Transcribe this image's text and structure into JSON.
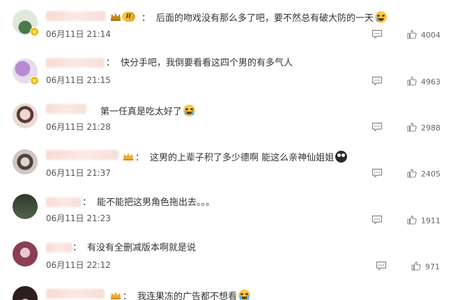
{
  "comments": [
    {
      "text": "后面的吻戏没有那么多了吧，要不然总有破大防的一天",
      "time": "06月11日 21:14",
      "likes": "4004",
      "colon": "：",
      "level_badge": "II",
      "emoji": "laugh-cry-emoji",
      "avatar_color": "#c9d8c2"
    },
    {
      "text": "快分手吧，我倒要看看这四个男的有多气人",
      "time": "06月11日 21:15",
      "likes": "4963",
      "colon": "：",
      "emoji": "",
      "avatar_color": "#d8c3e6"
    },
    {
      "text": "第一任真是吃太好了",
      "time": "06月11日 21:28",
      "likes": "2988",
      "colon": "",
      "emoji": "crying-emoji",
      "avatar_color": "#d5b9b4"
    },
    {
      "text": "这男的上辈子积了多少德啊 能这么亲神仙姐姐",
      "time": "06月11日 21:37",
      "likes": "2405",
      "colon": "：",
      "emoji": "dark-face-emoji",
      "avatar_color": "#b9b0ab"
    },
    {
      "text": "能不能把这男角色拖出去。。。",
      "time": "06月11日 21:23",
      "likes": "1911",
      "colon": "：",
      "emoji": "",
      "avatar_color": "#3b4a3a"
    },
    {
      "text": "有没有全删减版本啊就是说",
      "time": "06月11日 22:12",
      "likes": "971",
      "colon": "：",
      "emoji": "",
      "avatar_color": "#9e5a6a"
    },
    {
      "text": "我连果冻的广告都不想看",
      "time": "",
      "likes": "",
      "colon": "：",
      "emoji": "crying-emoji",
      "avatar_color": "#3a2a2a"
    }
  ],
  "icons": {
    "reply": "reply-icon",
    "like": "thumbs-up-icon",
    "crown": "crown-badge-icon",
    "verified": "verified-badge-icon"
  },
  "colors": {
    "text": "#333333",
    "meta": "#555555",
    "icon": "#888888",
    "badge": "#f5b900"
  }
}
